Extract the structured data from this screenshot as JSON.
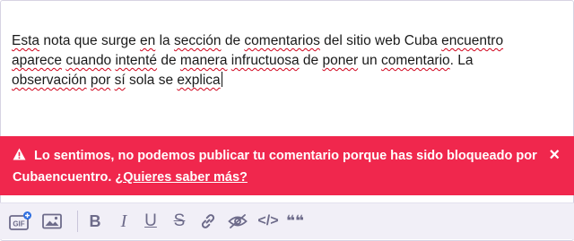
{
  "comment": {
    "line1": [
      {
        "t": "Esta",
        "sp": true
      },
      {
        "t": " nota que surge ",
        "sp": false
      },
      {
        "t": "en",
        "sp": true
      },
      {
        "t": " la ",
        "sp": false
      },
      {
        "t": "sección",
        "sp": true
      },
      {
        "t": " de ",
        "sp": false
      },
      {
        "t": "comentarios",
        "sp": true
      },
      {
        "t": " del sitio web Cuba ",
        "sp": false
      },
      {
        "t": "encuentro",
        "sp": true
      }
    ],
    "line2": [
      {
        "t": "aparece",
        "sp": true
      },
      {
        "t": " ",
        "sp": false
      },
      {
        "t": "cuando",
        "sp": true
      },
      {
        "t": " ",
        "sp": false
      },
      {
        "t": "intenté",
        "sp": true
      },
      {
        "t": " de ",
        "sp": false
      },
      {
        "t": "manera",
        "sp": true
      },
      {
        "t": " ",
        "sp": false
      },
      {
        "t": "infructuosa",
        "sp": true
      },
      {
        "t": " de ",
        "sp": false
      },
      {
        "t": "poner",
        "sp": true
      },
      {
        "t": " un ",
        "sp": false
      },
      {
        "t": "comentario",
        "sp": true
      },
      {
        "t": ". La",
        "sp": false
      }
    ],
    "line3": [
      {
        "t": "observación",
        "sp": true
      },
      {
        "t": " ",
        "sp": false
      },
      {
        "t": "por",
        "sp": true
      },
      {
        "t": " ",
        "sp": false
      },
      {
        "t": "sí",
        "sp": true
      },
      {
        "t": " sola se ",
        "sp": false
      },
      {
        "t": "explica",
        "sp": true
      }
    ]
  },
  "error": {
    "message": "Lo sentimos, no podemos publicar tu comentario porque has sido bloqueado por Cubaencuentro.",
    "link": "¿Quieres saber más?",
    "close": "×",
    "color": "#f0274d"
  },
  "toolbar": {
    "gif_label": "GIF",
    "icons": [
      "gif-icon",
      "image-icon",
      "bold-icon",
      "italic-icon",
      "underline-icon",
      "strikethrough-icon",
      "link-icon",
      "spoiler-icon",
      "code-icon",
      "quote-icon"
    ],
    "bold": "B",
    "italic": "I",
    "underline": "U",
    "strike": "S",
    "code": "</>",
    "quote": "❝❝"
  }
}
